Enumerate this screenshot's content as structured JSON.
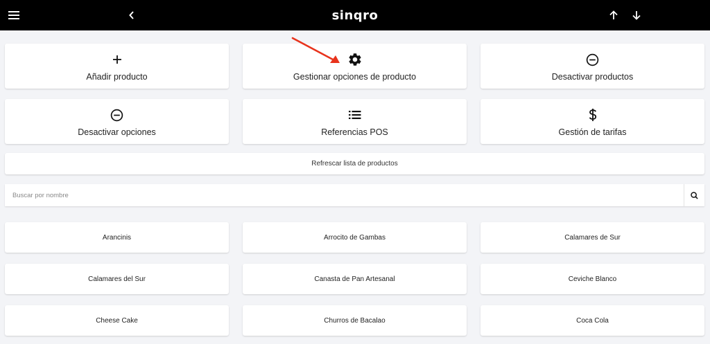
{
  "header": {
    "logo": "sinqro",
    "menu_icon": "hamburger-menu-icon",
    "back_icon": "chevron-left-icon",
    "up_icon": "arrow-up-icon",
    "down_icon": "arrow-down-icon"
  },
  "actions": [
    {
      "label": "Añadir producto",
      "icon": "plus-icon"
    },
    {
      "label": "Gestionar opciones de producto",
      "icon": "gear-icon"
    },
    {
      "label": "Desactivar productos",
      "icon": "minus-circle-icon"
    },
    {
      "label": "Desactivar opciones",
      "icon": "minus-circle-icon"
    },
    {
      "label": "Referencias POS",
      "icon": "list-icon"
    },
    {
      "label": "Gestión de tarifas",
      "icon": "dollar-icon"
    }
  ],
  "refresh": {
    "label": "Refrescar lista de productos"
  },
  "search": {
    "placeholder": "Buscar por nombre",
    "value": "",
    "icon": "search-icon"
  },
  "products": [
    "Arancinis",
    "Arrocito de Gambas",
    "Calamares de Sur",
    "Calamares del Sur",
    "Canasta de Pan Artesanal",
    "Ceviche Blanco",
    "Cheese Cake",
    "Churros de Bacalao",
    "Coca Cola"
  ],
  "annotation": {
    "color": "#e8331c"
  }
}
